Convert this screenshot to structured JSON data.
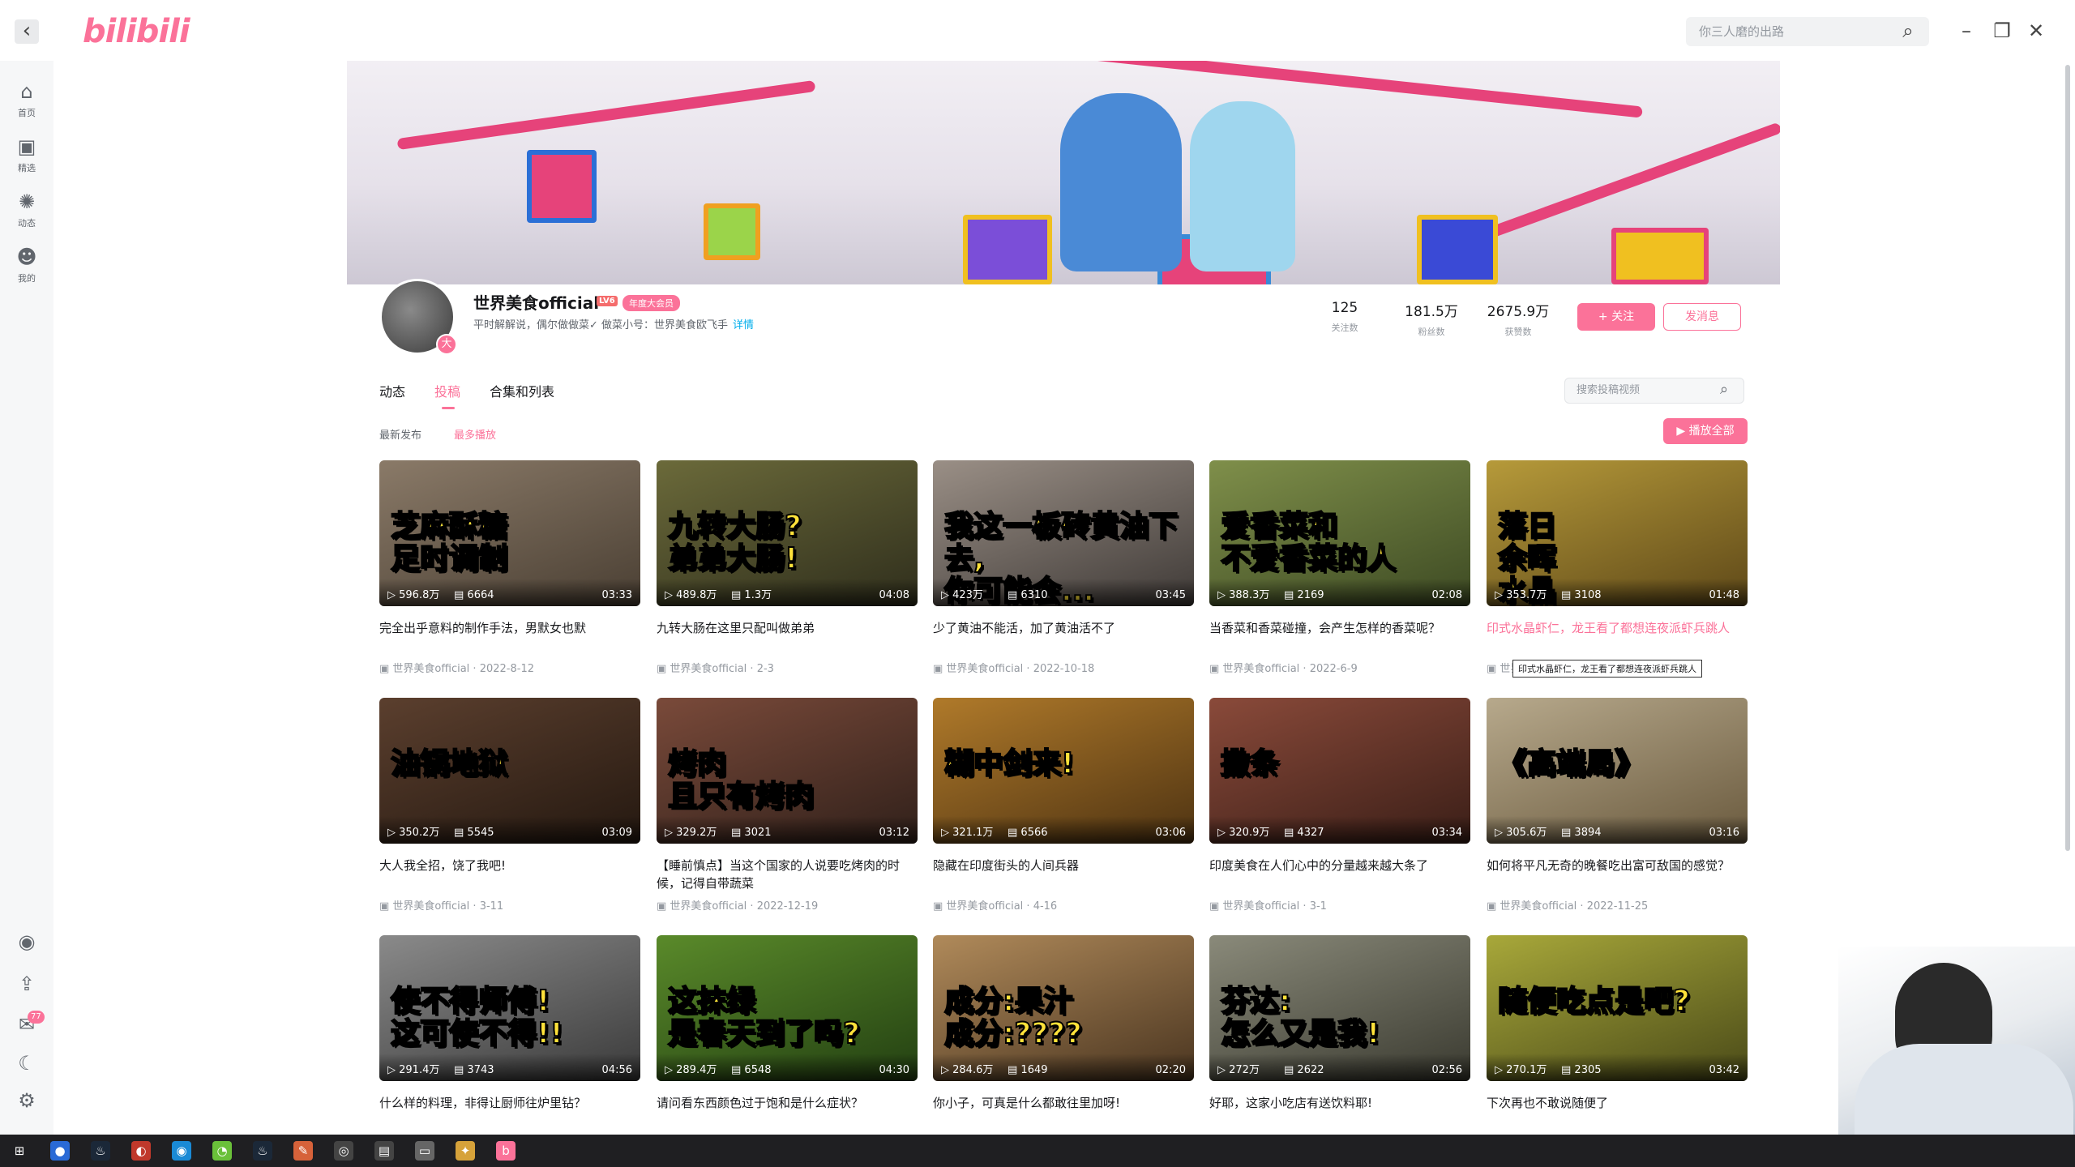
{
  "window": {
    "logo": "bilibili",
    "search_text": "你三人磨的出路"
  },
  "rail": [
    {
      "label": "首页",
      "icon": "home-icon",
      "glyph": "⌂"
    },
    {
      "label": "精选",
      "icon": "featured-icon",
      "glyph": "▣"
    },
    {
      "label": "动态",
      "icon": "dynamic-icon",
      "glyph": "✺"
    },
    {
      "label": "我的",
      "icon": "mine-icon",
      "glyph": "☻"
    }
  ],
  "rail_bottom": {
    "badge": "77"
  },
  "profile": {
    "name": "世界美食official",
    "level": "LV6",
    "vip": "年度大会员",
    "avatar_badge": "大",
    "sign": "平时解解说，偶尔做做菜✓ 做菜小号：世界美食欧飞手",
    "sign_more": "详情",
    "stats": [
      {
        "value": "125",
        "label": "关注数"
      },
      {
        "value": "181.5万",
        "label": "粉丝数"
      },
      {
        "value": "2675.9万",
        "label": "获赞数"
      }
    ],
    "follow_label": "+ 关注",
    "message_label": "发消息"
  },
  "tabs": [
    "动态",
    "投稿",
    "合集和列表"
  ],
  "search_placeholder": "搜索投稿视频",
  "sort": [
    "最新发布",
    "最多播放"
  ],
  "play_all": "▶ 播放全部",
  "videos": [
    {
      "thumb": "芝麻酥糖\n足时调制",
      "title": "完全出乎意料的制作手法，男默女也默",
      "plays": "596.8万",
      "danmaku": "6664",
      "duration": "03:33",
      "author": "世界美食official",
      "date": "2022-8-12",
      "bg": [
        "#8a7a68",
        "#4a3f33"
      ]
    },
    {
      "thumb": "九转大肠?\n弟弟大肠!",
      "title": "九转大肠在这里只配叫做弟弟",
      "plays": "489.8万",
      "danmaku": "1.3万",
      "duration": "04:08",
      "author": "世界美食official",
      "date": "2-3",
      "bg": [
        "#6b6a3a",
        "#2f2e1c"
      ]
    },
    {
      "thumb": "我这一板砖黄油下去,\n你可能会...",
      "title": "少了黄油不能活，加了黄油活不了",
      "plays": "423万",
      "danmaku": "6310",
      "duration": "03:45",
      "author": "世界美食official",
      "date": "2022-10-18",
      "bg": [
        "#9a8f86",
        "#3f3a37"
      ]
    },
    {
      "thumb": "爱香菜和\n不爱香菜的人",
      "title": "当香菜和香菜碰撞，会产生怎样的香菜呢？",
      "plays": "388.3万",
      "danmaku": "2169",
      "duration": "02:08",
      "author": "世界美食official",
      "date": "2022-6-9",
      "bg": [
        "#7f8f4a",
        "#3d4a23"
      ]
    },
    {
      "thumb": "落日\n余晖\n水晶\n虾",
      "title": "印式水晶虾仁，龙王看了都想连夜派虾兵跳人",
      "plays": "353.7万",
      "danmaku": "3108",
      "duration": "01:48",
      "author": "世界美食official",
      "date": "",
      "bg": [
        "#b69a3a",
        "#5e4818"
      ],
      "highlight": true
    },
    {
      "thumb": "油锅地狱",
      "title": "大人我全招，饶了我吧!",
      "plays": "350.2万",
      "danmaku": "5545",
      "duration": "03:09",
      "author": "世界美食official",
      "date": "3-11",
      "bg": [
        "#5b3f2e",
        "#241810"
      ]
    },
    {
      "thumb": "烤肉\n且只有烤肉",
      "title": "【睡前慎点】当这个国家的人说要吃烤肉的时候，记得自带蔬菜",
      "plays": "329.2万",
      "danmaku": "3021",
      "duration": "03:12",
      "author": "世界美食official",
      "date": "2022-12-19",
      "bg": [
        "#7a4a3a",
        "#30201a"
      ]
    },
    {
      "thumb": "糊中剑来!",
      "title": "隐藏在印度街头的人间兵器",
      "plays": "321.1万",
      "danmaku": "6566",
      "duration": "03:06",
      "author": "世界美食official",
      "date": "4-16",
      "bg": [
        "#b07a2a",
        "#4e3312"
      ]
    },
    {
      "thumb": "撒条",
      "title": "印度美食在人们心中的分量越来越大条了",
      "plays": "320.9万",
      "danmaku": "4327",
      "duration": "03:34",
      "author": "世界美食official",
      "date": "3-1",
      "bg": [
        "#8a4a3a",
        "#3a1e17"
      ]
    },
    {
      "thumb": "《高端局》",
      "title": "如何将平凡无奇的晚餐吃出富可敌国的感觉？",
      "plays": "305.6万",
      "danmaku": "3894",
      "duration": "03:16",
      "author": "世界美食official",
      "date": "2022-11-25",
      "bg": [
        "#b7a98c",
        "#6a5a3e"
      ]
    },
    {
      "thumb": "使不得师傅!\n这可使不得!!",
      "title": "什么样的料理，非得让厨师往炉里钻？",
      "plays": "291.4万",
      "danmaku": "3743",
      "duration": "04:56",
      "author": "",
      "date": "",
      "bg": [
        "#8a8a8a",
        "#3a3a3a"
      ]
    },
    {
      "thumb": "这抹绿\n是春天到了吗?",
      "title": "请问看东西颜色过于饱和是什么症状？",
      "plays": "289.4万",
      "danmaku": "6548",
      "duration": "04:30",
      "author": "",
      "date": "",
      "bg": [
        "#5a8a2a",
        "#234012"
      ]
    },
    {
      "thumb": "成分:果汁\n成分:????",
      "title": "你小子，可真是什么都敢往里加呀!",
      "plays": "284.6万",
      "danmaku": "1649",
      "duration": "02:20",
      "author": "",
      "date": "",
      "bg": [
        "#b08a5a",
        "#4a3520"
      ]
    },
    {
      "thumb": "芬达:\n怎么又是我!",
      "title": "好耶，这家小吃店有送饮料耶!",
      "plays": "272万",
      "danmaku": "2622",
      "duration": "02:56",
      "author": "",
      "date": "",
      "bg": [
        "#8a8a7a",
        "#3a3a30"
      ]
    },
    {
      "thumb": "随便吃点是吧?",
      "title": "下次再也不敢说随便了",
      "plays": "270.1万",
      "danmaku": "2305",
      "duration": "03:42",
      "author": "",
      "date": "",
      "bg": [
        "#a8a83a",
        "#4a4a18"
      ]
    }
  ],
  "tooltip": "印式水晶虾仁，龙王看了都想连夜派虾兵跳人",
  "colors": {
    "accent": "#fb7299",
    "link": "#00aeec"
  }
}
